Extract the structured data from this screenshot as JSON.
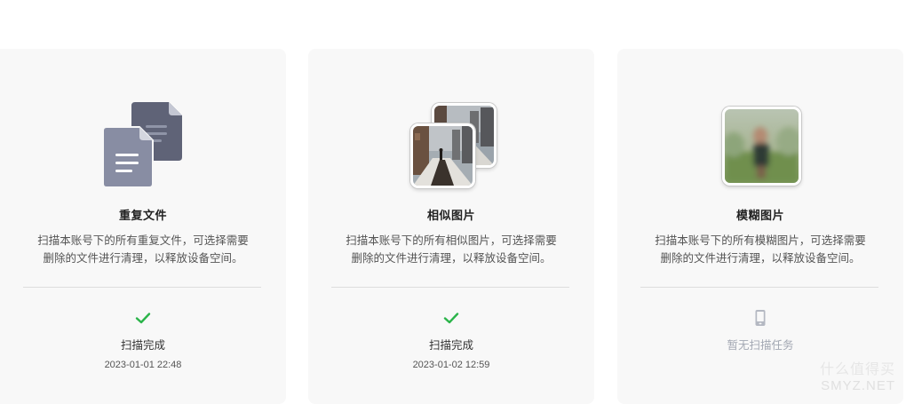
{
  "cards": [
    {
      "title": "重复文件",
      "desc_line1": "扫描本账号下的所有重复文件，可选择需要",
      "desc_line2": "删除的文件进行清理，以释放设备空间。",
      "status_icon": "checkmark-icon",
      "status": "扫描完成",
      "time": "2023-01-01 22:48"
    },
    {
      "title": "相似图片",
      "desc_line1": "扫描本账号下的所有相似图片，可选择需要",
      "desc_line2": "删除的文件进行清理，以释放设备空间。",
      "status_icon": "checkmark-icon",
      "status": "扫描完成",
      "time": "2023-01-02 12:59"
    },
    {
      "title": "模糊图片",
      "desc_line1": "扫描本账号下的所有模糊图片，可选择需要",
      "desc_line2": "删除的文件进行清理，以释放设备空间。",
      "status_icon": "phone-icon",
      "status": "暂无扫描任务",
      "time": ""
    }
  ],
  "watermark": {
    "line1": "什么值得买",
    "line2": "SMYZ.NET"
  },
  "colors": {
    "card_bg": "#f8f8f8",
    "success_green": "#2bb44a",
    "doc_back": "#5f6377",
    "doc_front": "#888da3",
    "muted_text": "#a3a8b3"
  }
}
